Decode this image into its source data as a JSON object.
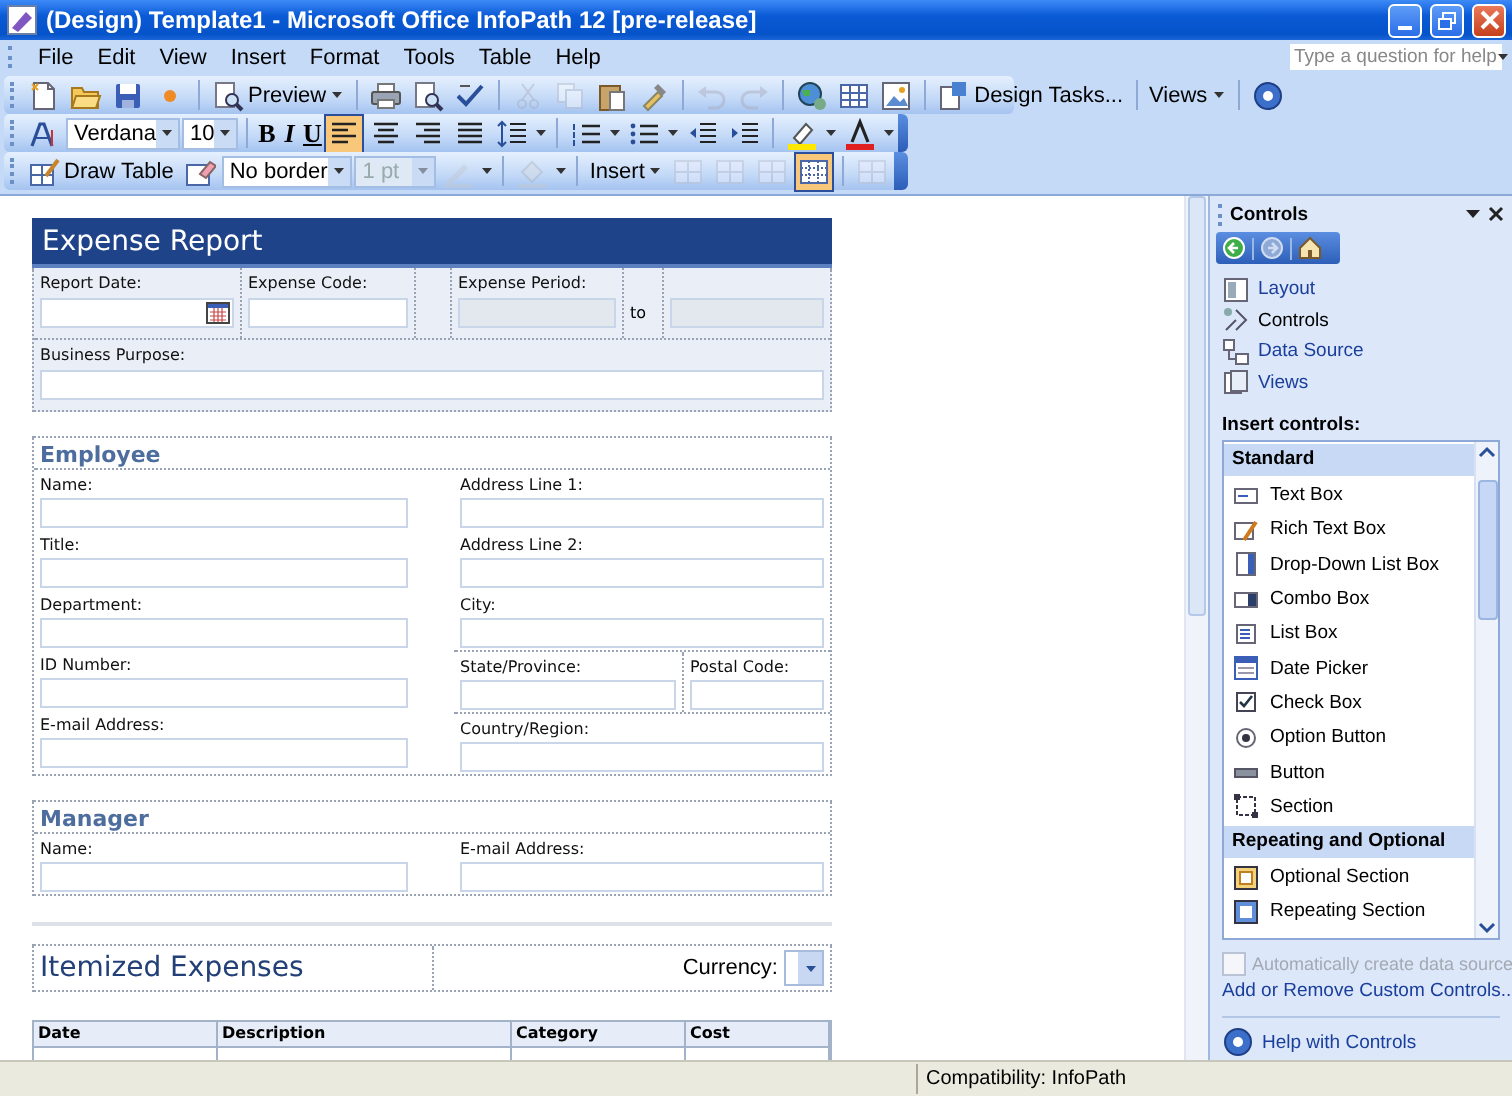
{
  "window": {
    "title": "(Design) Template1 - Microsoft Office InfoPath 12 [pre-release]"
  },
  "menu": [
    "File",
    "Edit",
    "View",
    "Insert",
    "Format",
    "Tools",
    "Table",
    "Help"
  ],
  "help_search": {
    "placeholder": "Type a question for help"
  },
  "standard_toolbar": {
    "preview": "Preview",
    "design_tasks": "Design Tasks...",
    "views": "Views"
  },
  "formatting_toolbar": {
    "font": "Verdana",
    "size": "10",
    "bold": "B",
    "italic": "I",
    "underline": "U",
    "align_left_pressed": true
  },
  "table_toolbar": {
    "draw_table": "Draw Table",
    "border": "No border",
    "weight": {
      "value": "1 pt",
      "disabled": true
    },
    "insert": "Insert",
    "gridlines_pressed": true
  },
  "form": {
    "title": "Expense Report",
    "report_date": {
      "label": "Report Date:"
    },
    "expense_code": {
      "label": "Expense Code:"
    },
    "expense_period": {
      "label": "Expense Period:",
      "separator": "to",
      "disabled": true
    },
    "business_purpose": {
      "label": "Business Purpose:"
    },
    "sections": [
      {
        "heading": "Employee",
        "left": [
          "Name:",
          "Title:",
          "Department:",
          "ID Number:",
          "E-mail Address:"
        ],
        "right": [
          [
            "Address Line 1:"
          ],
          [
            "Address Line 2:"
          ],
          [
            "City:"
          ],
          [
            "State/Province:",
            "Postal Code:"
          ],
          [
            "Country/Region:"
          ]
        ]
      },
      {
        "heading": "Manager",
        "left": [
          "Name:"
        ],
        "right": [
          [
            "E-mail Address:"
          ]
        ]
      }
    ],
    "itemized": {
      "heading": "Itemized Expenses",
      "currency_label": "Currency:",
      "columns": [
        "Date",
        "Description",
        "Category",
        "Cost"
      ]
    }
  },
  "task_pane": {
    "title": "Controls",
    "links": [
      {
        "label": "Layout",
        "selected": false
      },
      {
        "label": "Controls",
        "selected": true
      },
      {
        "label": "Data Source",
        "selected": false
      },
      {
        "label": "Views",
        "selected": false
      }
    ],
    "insert_label": "Insert controls:",
    "groups": [
      {
        "name": "Standard",
        "items": [
          "Text Box",
          "Rich Text Box",
          "Drop-Down List Box",
          "Combo Box",
          "List Box",
          "Date Picker",
          "Check Box",
          "Option Button",
          "Button",
          "Section"
        ]
      },
      {
        "name": "Repeating and Optional",
        "items": [
          "Optional Section",
          "Repeating Section"
        ]
      }
    ],
    "auto_create": {
      "label": "Automatically create data source",
      "checked": false,
      "disabled": true
    },
    "custom_link": "Add or Remove Custom Controls...",
    "help_link": "Help with Controls"
  },
  "status_bar": {
    "compatibility": "Compatibility: InfoPath"
  }
}
